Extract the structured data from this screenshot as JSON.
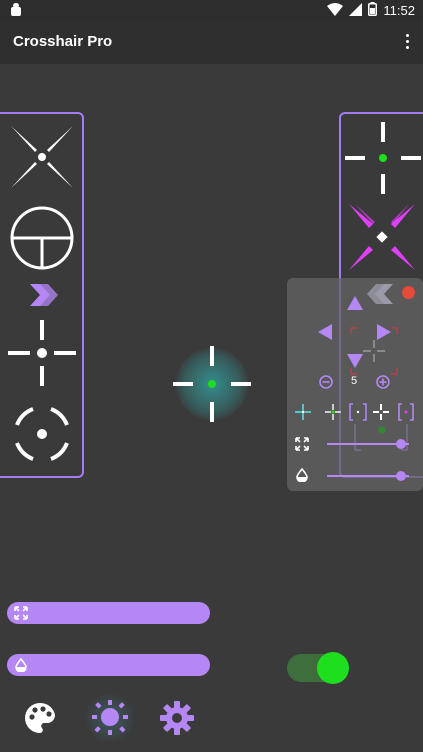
{
  "status_bar": {
    "time": "11:52",
    "icons": [
      "android-icon",
      "wifi-icon",
      "signal-icon",
      "battery-icon"
    ]
  },
  "app_bar": {
    "title": "Crosshair Pro",
    "menu_icon": "more-vert-icon"
  },
  "left_panel": {
    "items": [
      "x-crosshair-icon",
      "scope-crosshair-icon",
      "double-chevron-right-icon",
      "dot-plus-crosshair-icon",
      "circle-dot-crosshair-icon"
    ]
  },
  "right_panel": {
    "items": [
      "green-dot-plus-crosshair-icon",
      "magenta-x-crosshair-icon"
    ]
  },
  "center_crosshair": {
    "icon": "green-dot-crosshair-icon",
    "dot_color": "#1ddf1d",
    "glow_color": "#2a8a8a"
  },
  "controls_overlay": {
    "collapse_icon": "double-chevron-left-icon",
    "close_color": "#e64a3b",
    "size_value": "5",
    "presets": [
      "teal-cross-preset",
      "green-cross-preset",
      "purple-bracket-preset",
      "white-cross-preset",
      "purple-box-preset"
    ],
    "scale_slider_value": 0.9,
    "opacity_slider_value": 0.9
  },
  "bottom_sliders": {
    "size_slider": {
      "icon": "expand-icon"
    },
    "opacity_slider": {
      "icon": "opacity-icon"
    }
  },
  "toggle": {
    "on": true,
    "on_color": "#1ddf1d"
  },
  "bottom_nav": {
    "items": [
      "palette-icon",
      "brightness-icon",
      "settings-icon"
    ]
  },
  "colors": {
    "accent": "#b487f5",
    "panel_border": "#a47cf0",
    "magenta": "#e040fb",
    "green": "#1ddf1d"
  }
}
